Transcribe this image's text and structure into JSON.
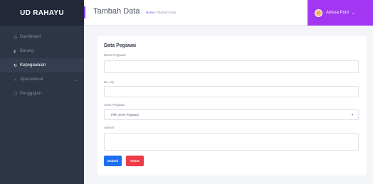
{
  "sidebar": {
    "brand": "UD RAHAYU",
    "items": [
      {
        "icon": "◷",
        "label": "Dashboard",
        "active": false
      },
      {
        "icon": "▮",
        "label": "Barang",
        "active": false
      },
      {
        "icon": "↻",
        "label": "Kepegawaian",
        "active": true
      },
      {
        "icon": "✓",
        "label": "Operasional",
        "active": false,
        "chevron": "⌄"
      },
      {
        "icon": "☐",
        "label": "Penggajian",
        "active": false
      }
    ]
  },
  "header": {
    "title": "Tambah Data",
    "breadcrumb_home": "Home",
    "breadcrumb_sep": "/",
    "breadcrumb_current": "Tambah Data",
    "user_name": "Anissa Putri",
    "user_chevron": "⌄",
    "accent_color": "#8a3cf5",
    "user_bg": "#a236f2"
  },
  "form": {
    "title": "Data Pegawai",
    "nama_label": "Nama Pegawai",
    "nama_value": "",
    "hp_label": "No. Hp",
    "hp_value": "",
    "jenis_label": "Jenis Pegawai",
    "jenis_selected": "Pilih Jenis Pegawai",
    "alamat_label": "Alamat",
    "alamat_value": "",
    "submit_label": "Submit",
    "reset_label": "Reset"
  }
}
